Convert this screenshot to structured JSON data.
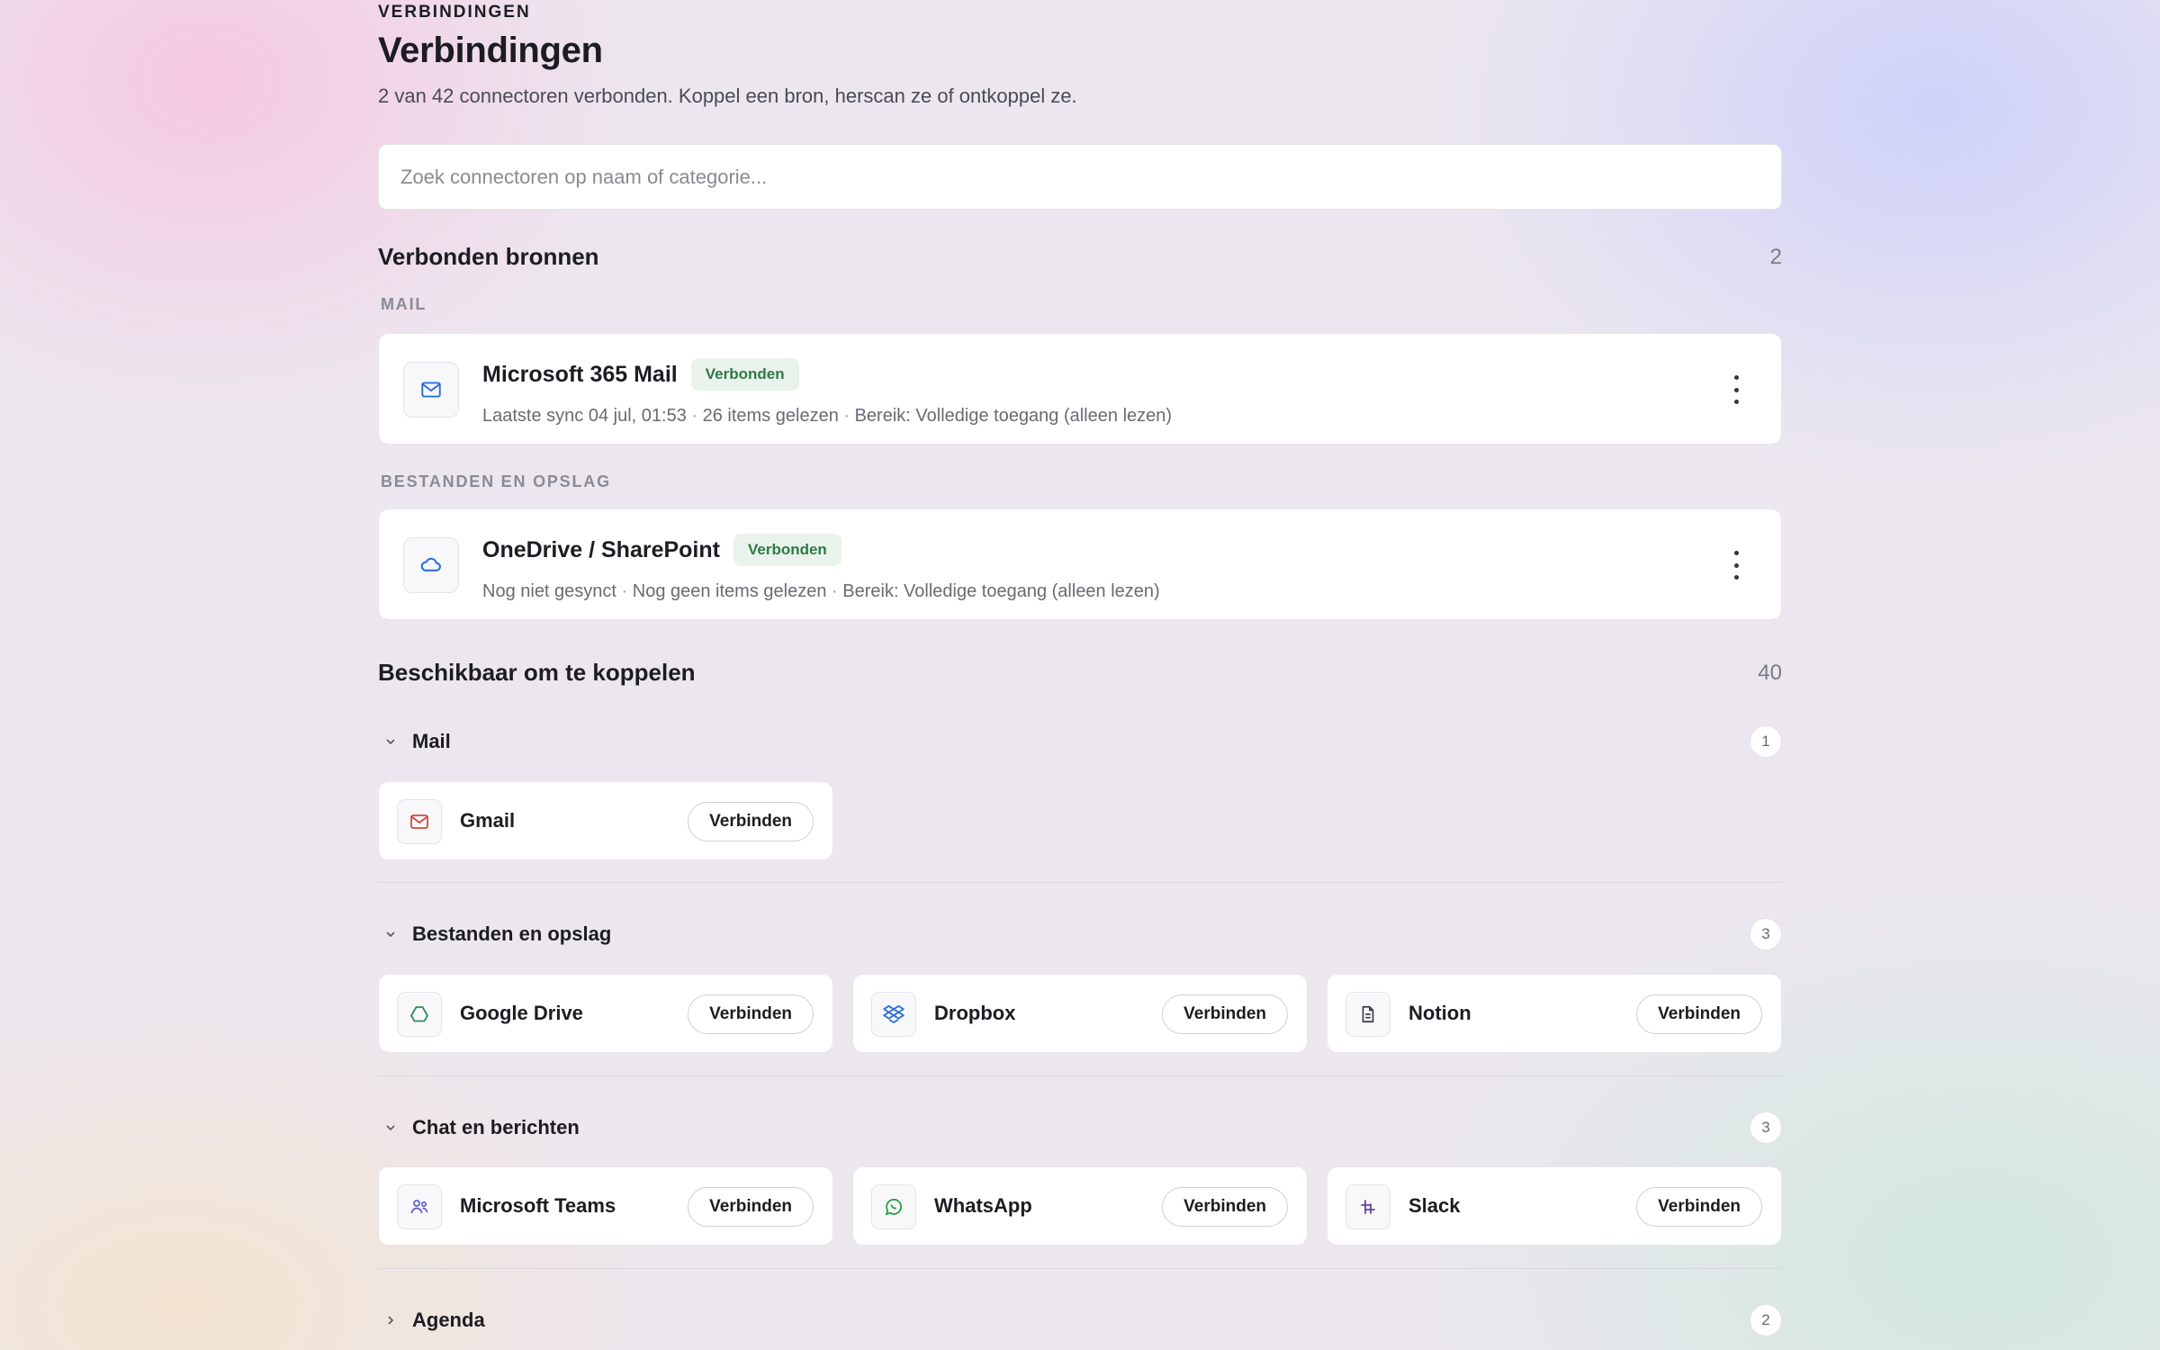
{
  "header": {
    "eyebrow": "VERBINDINGEN",
    "title": "Verbindingen",
    "subtitle": "2 van 42 connectoren verbonden. Koppel een bron, herscan ze of ontkoppel ze."
  },
  "search": {
    "placeholder": "Zoek connectoren op naam of categorie..."
  },
  "connected": {
    "heading": "Verbonden bronnen",
    "count": "2",
    "groups": [
      {
        "label": "MAIL",
        "name": "Microsoft 365 Mail",
        "badge": "Verbonden",
        "meta": [
          "Laatste sync 04 jul, 01:53",
          "26 items gelezen",
          "Bereik: Volledige toegang (alleen lezen)"
        ],
        "icon": "mail-icon"
      },
      {
        "label": "BESTANDEN EN OPSLAG",
        "name": "OneDrive / SharePoint",
        "badge": "Verbonden",
        "meta": [
          "Nog niet gesynct",
          "Nog geen items gelezen",
          "Bereik: Volledige toegang (alleen lezen)"
        ],
        "icon": "cloud-icon"
      }
    ]
  },
  "available": {
    "heading": "Beschikbaar om te koppelen",
    "count": "40",
    "connect_label": "Verbinden",
    "categories": [
      {
        "title": "Mail",
        "count": "1",
        "expanded": true,
        "items": [
          {
            "name": "Gmail",
            "icon": "gmail-icon"
          }
        ]
      },
      {
        "title": "Bestanden en opslag",
        "count": "3",
        "expanded": true,
        "items": [
          {
            "name": "Google Drive",
            "icon": "google-drive-icon"
          },
          {
            "name": "Dropbox",
            "icon": "dropbox-icon"
          },
          {
            "name": "Notion",
            "icon": "notion-icon"
          }
        ]
      },
      {
        "title": "Chat en berichten",
        "count": "3",
        "expanded": true,
        "items": [
          {
            "name": "Microsoft Teams",
            "icon": "teams-icon"
          },
          {
            "name": "WhatsApp",
            "icon": "whatsapp-icon"
          },
          {
            "name": "Slack",
            "icon": "slack-icon"
          }
        ]
      },
      {
        "title": "Agenda",
        "count": "2",
        "expanded": false,
        "items": []
      }
    ]
  },
  "colors": {
    "badge_bg": "#e9f3ec",
    "badge_text": "#2f7a48",
    "accent_blue": "#2f6fd6"
  }
}
